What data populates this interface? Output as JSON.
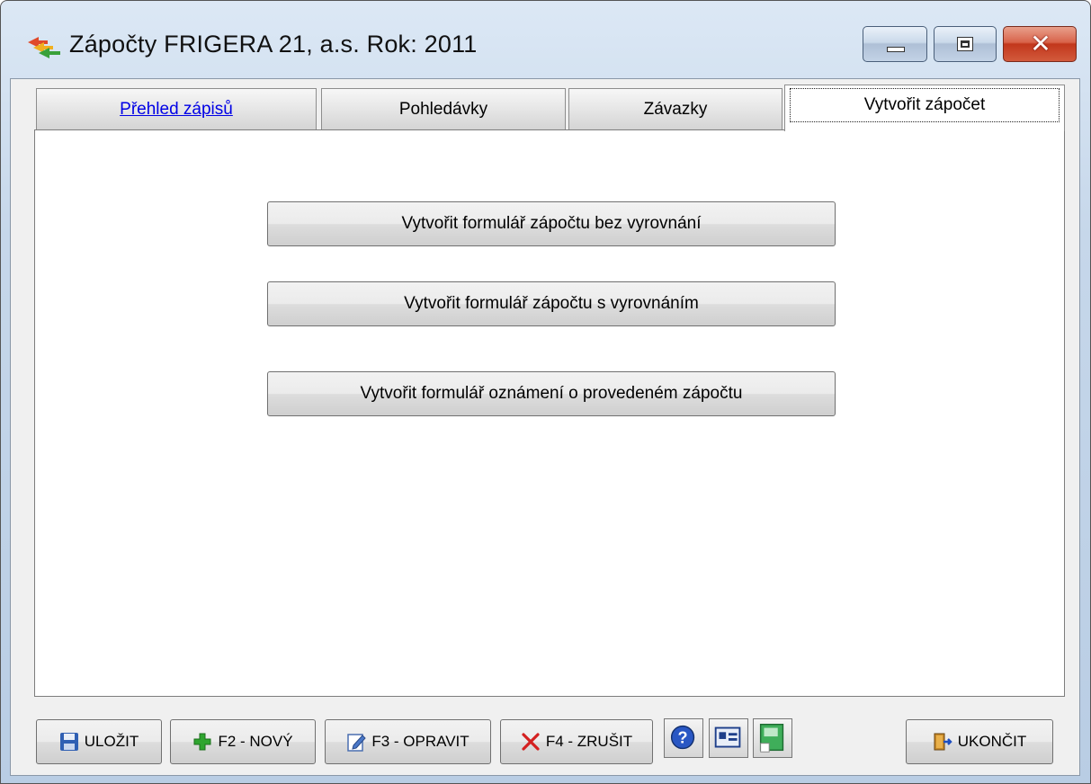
{
  "window": {
    "title": "Zápočty  FRIGERA 21, a.s.  Rok: 2011",
    "controls": {
      "minimize": "minimize",
      "maximize": "maximize",
      "close": "✕"
    }
  },
  "tabs": [
    {
      "label": "Přehled zápisů",
      "active": false
    },
    {
      "label": "Pohledávky",
      "active": false
    },
    {
      "label": "Závazky",
      "active": false
    },
    {
      "label": "Vytvořit zápočet",
      "active": true
    }
  ],
  "actions": {
    "without_settlement": "Vytvořit formulář zápočtu bez vyrovnání",
    "with_settlement": "Vytvořit formulář zápočtu s vyrovnáním",
    "notice": "Vytvořit formulář oznámení o provedeném zápočtu"
  },
  "toolbar": {
    "save": "ULOŽIT",
    "new": "F2 - NOVÝ",
    "edit": "F3 - OPRAVIT",
    "cancel": "F4 - ZRUŠIT",
    "exit": "UKONČIT"
  },
  "icons": {
    "app": "app-arrows-icon",
    "save": "floppy-disk-icon",
    "new": "plus-icon",
    "edit": "pencil-note-icon",
    "cancel": "red-x-icon",
    "help": "help-question-icon",
    "card": "id-card-icon",
    "export": "green-document-icon",
    "exit": "door-exit-icon"
  },
  "colors": {
    "link": "#0000e6",
    "close_button": "#c2371c",
    "panel_background": "#ffffff"
  }
}
